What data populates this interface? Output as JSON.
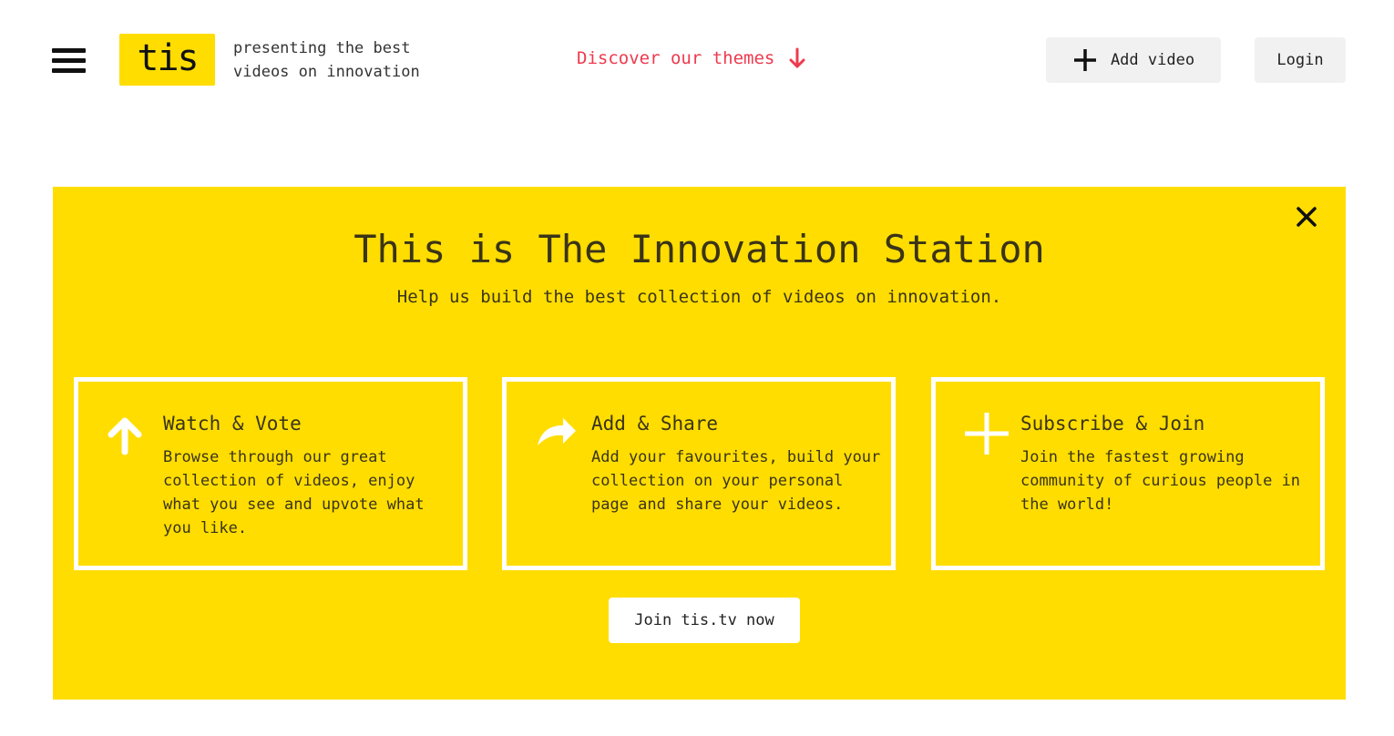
{
  "header": {
    "logo_text": "tis",
    "tagline": "presenting the best\nvideos on innovation",
    "discover_label": "Discover our themes",
    "add_video_label": "Add video",
    "login_label": "Login"
  },
  "banner": {
    "title": "This is The Innovation Station",
    "subtitle": "Help us build the best collection of videos on innovation.",
    "cards": [
      {
        "icon": "arrow-up-icon",
        "title": "Watch & Vote",
        "text": "Browse through our great collection of videos, enjoy what you see and upvote what you like."
      },
      {
        "icon": "share-icon",
        "title": "Add & Share",
        "text": "Add your favourites, build your collection on your personal page and share your videos."
      },
      {
        "icon": "plus-icon",
        "title": "Subscribe & Join",
        "text": "Join the fastest growing community of curious people in the world!"
      }
    ],
    "join_label": "Join tis.tv now"
  },
  "colors": {
    "brand_yellow": "#ffdd00",
    "accent_red": "#ee3a4e",
    "button_grey": "#f1f1f1"
  }
}
